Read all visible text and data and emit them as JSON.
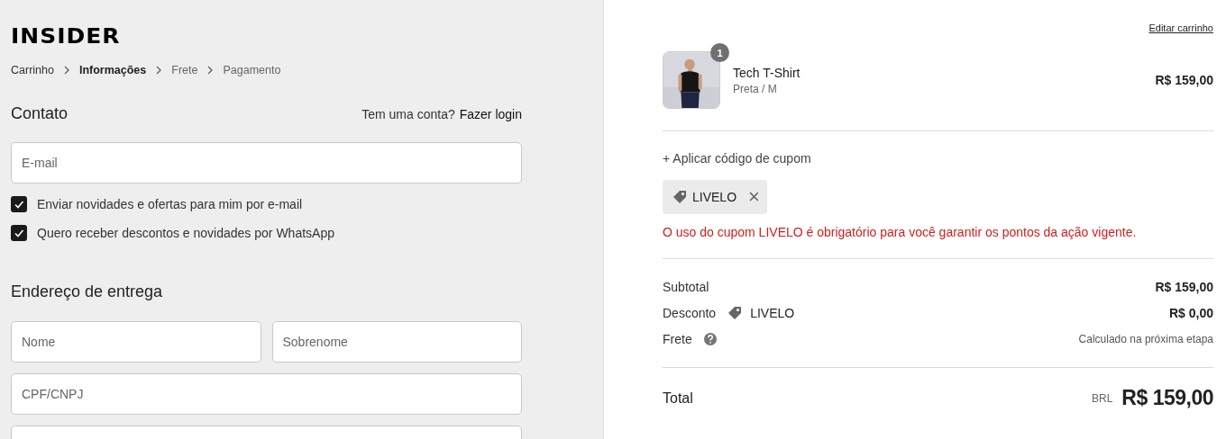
{
  "brand": "INSIDER",
  "breadcrumb": [
    {
      "label": "Carrinho",
      "kind": "link"
    },
    {
      "label": "Informações",
      "kind": "current"
    },
    {
      "label": "Frete",
      "kind": "upcoming"
    },
    {
      "label": "Pagamento",
      "kind": "upcoming"
    }
  ],
  "contact": {
    "title": "Contato",
    "login_prompt": "Tem uma conta?",
    "login_link": "Fazer login",
    "email": {
      "placeholder": "E-mail"
    },
    "options": [
      {
        "label": "Enviar novidades e ofertas para mim por e-mail",
        "checked": true
      },
      {
        "label": "Quero receber descontos e novidades por WhatsApp",
        "checked": true
      }
    ]
  },
  "shipping": {
    "title": "Endereço de entrega",
    "rows": [
      [
        {
          "placeholder": "Nome"
        },
        {
          "placeholder": "Sobrenome"
        }
      ],
      [
        {
          "placeholder": "CPF/CNPJ"
        }
      ],
      [
        {}
      ]
    ]
  },
  "summary": {
    "edit_link": "Editar carrinho",
    "items": [
      {
        "quantity": "1",
        "name": "Tech T-Shirt",
        "variant": "Preta / M",
        "price": "R$ 159,00"
      }
    ],
    "coupon_toggle": "+ Aplicar código de cupom",
    "coupon": {
      "code": "LIVELO",
      "remove": "×"
    },
    "coupon_error": "O uso do cupom LIVELO é obrigatório para você garantir os pontos da ação vigente.",
    "lines": [
      {
        "label": "Subtotal",
        "value": "R$ 159,00",
        "kind": "plain"
      },
      {
        "label": "Desconto",
        "tag": "LIVELO",
        "value": "R$ 0,00",
        "kind": "discount"
      },
      {
        "label": "Frete",
        "value": "Calculado na próxima etapa",
        "kind": "help"
      }
    ],
    "total": {
      "label": "Total",
      "currency": "BRL",
      "value": "R$ 159,00"
    }
  }
}
